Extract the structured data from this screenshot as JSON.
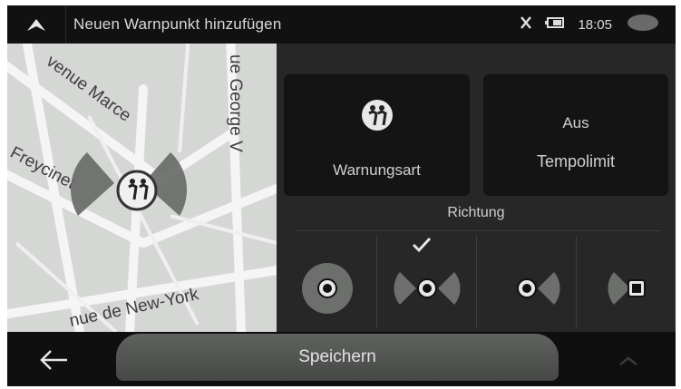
{
  "header": {
    "title": "Neuen Warnpunkt hinzufügen",
    "time": "18:05"
  },
  "map": {
    "streets": [
      "venue Marce",
      "ue George V",
      "Freycinet",
      "nue de New-York"
    ]
  },
  "options": {
    "warning_type_label": "Warnungsart",
    "speed_limit_value": "Aus",
    "speed_limit_label": "Tempolimit"
  },
  "direction": {
    "label": "Richtung",
    "selected_index": 1,
    "choices": [
      "both-directions-icon",
      "two-way-icon",
      "forward-icon",
      "backward-icon"
    ]
  },
  "footer": {
    "save_label": "Speichern"
  },
  "colors": {
    "background": "#1b1b1b",
    "tile": "#141414",
    "map": "#d6d8d6",
    "sector": "#6c6e6c",
    "save_button": "#555855"
  }
}
